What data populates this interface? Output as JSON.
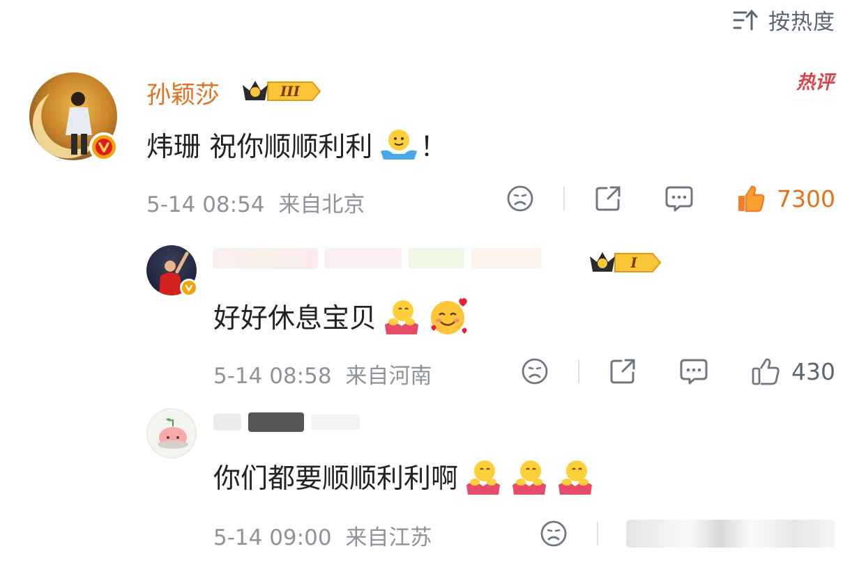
{
  "sort": {
    "label": "按热度",
    "icon": "sort-icon"
  },
  "comments": [
    {
      "username": "孙颖莎",
      "level": "III",
      "hot_tag": "热评",
      "text": "炜珊 祝你顺顺利利",
      "text_suffix": "！",
      "time": "5-14 08:54",
      "location": "来自北京",
      "likes": "7300"
    },
    {
      "level": "I",
      "text": "好好休息宝贝",
      "time": "5-14 08:58",
      "location": "来自河南",
      "likes": "430"
    },
    {
      "text": "你们都要顺顺利利啊",
      "time": "5-14 09:00",
      "location": "来自江苏"
    }
  ],
  "colors": {
    "accent": "#e2701c",
    "hot": "#d9434a",
    "meta": "#8e9399",
    "icon": "#5b6470"
  }
}
